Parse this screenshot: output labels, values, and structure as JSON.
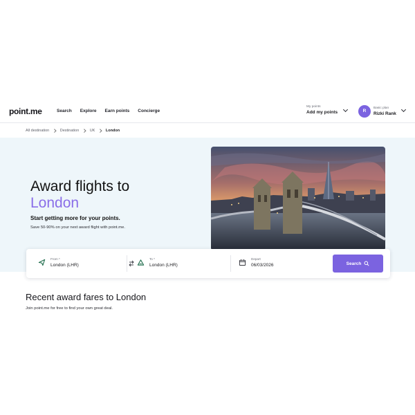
{
  "brand": {
    "logo": "point.me",
    "accent": "#7b63e0"
  },
  "nav": {
    "items": [
      "Search",
      "Explore",
      "Earn points",
      "Concierge"
    ],
    "points": {
      "label": "My points",
      "action": "Add my points"
    },
    "profile": {
      "initial": "R",
      "plan": "Basic plan",
      "name": "Rizki Rank"
    }
  },
  "breadcrumb": [
    "All destination",
    "Destination",
    "UK",
    "London"
  ],
  "hero": {
    "title_line1": "Award flights to",
    "title_accent": "London",
    "tagline": "Start getting more for your points.",
    "subtitle": "Save 50-90% on your next award flight with point.me."
  },
  "search": {
    "from": {
      "label": "From *",
      "value": "London (LHR)",
      "icon": "takeoff-icon"
    },
    "to": {
      "label": "To *",
      "value": "London (LHR)",
      "icon": "landing-icon"
    },
    "depart": {
      "label": "Depart",
      "value": "06/03/2026",
      "icon": "calendar-icon"
    },
    "button": "Search"
  },
  "recent": {
    "title": "Recent award fares to London",
    "subtitle": "Join point.me for free to find your own great deal."
  }
}
